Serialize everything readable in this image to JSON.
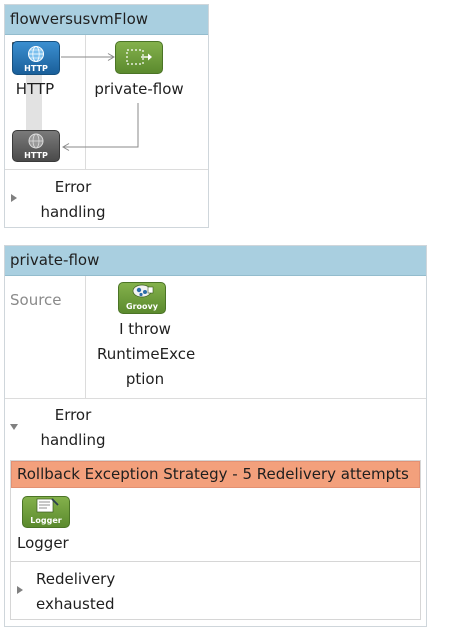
{
  "flow1": {
    "title": "flowversusvmFlow",
    "http_label": "HTTP",
    "http_icon_text": "HTTP",
    "http_response_icon_text": "HTTP",
    "private_flow_label": "private-flow",
    "error_handling_line1": "Error",
    "error_handling_line2": "handling"
  },
  "flow2": {
    "title": "private-flow",
    "source_label": "Source",
    "groovy_icon_text": "Groovy",
    "groovy_label_line1": "I throw",
    "groovy_label_line2": "RuntimeExce",
    "groovy_label_line3": "ption",
    "error_handling_line1": "Error",
    "error_handling_line2": "handling",
    "strategy_label": "Rollback Exception Strategy - 5 Redelivery attempts",
    "logger_icon_text": "Logger",
    "logger_label": "Logger",
    "redelivery_line1": "Redelivery",
    "redelivery_line2": "exhausted"
  },
  "icons": {
    "http_listener": "http-globe-icon",
    "http_response": "http-response-icon",
    "flow_ref": "flow-reference-icon",
    "groovy": "groovy-script-icon",
    "logger": "logger-icon",
    "sync": "exchange-pattern-icon"
  },
  "colors": {
    "header": "#a9cfe0",
    "strategy": "#f3a07c",
    "http_blue": "#1e6fae",
    "flowref_green": "#6e9a3c",
    "http_dark": "#555555"
  }
}
